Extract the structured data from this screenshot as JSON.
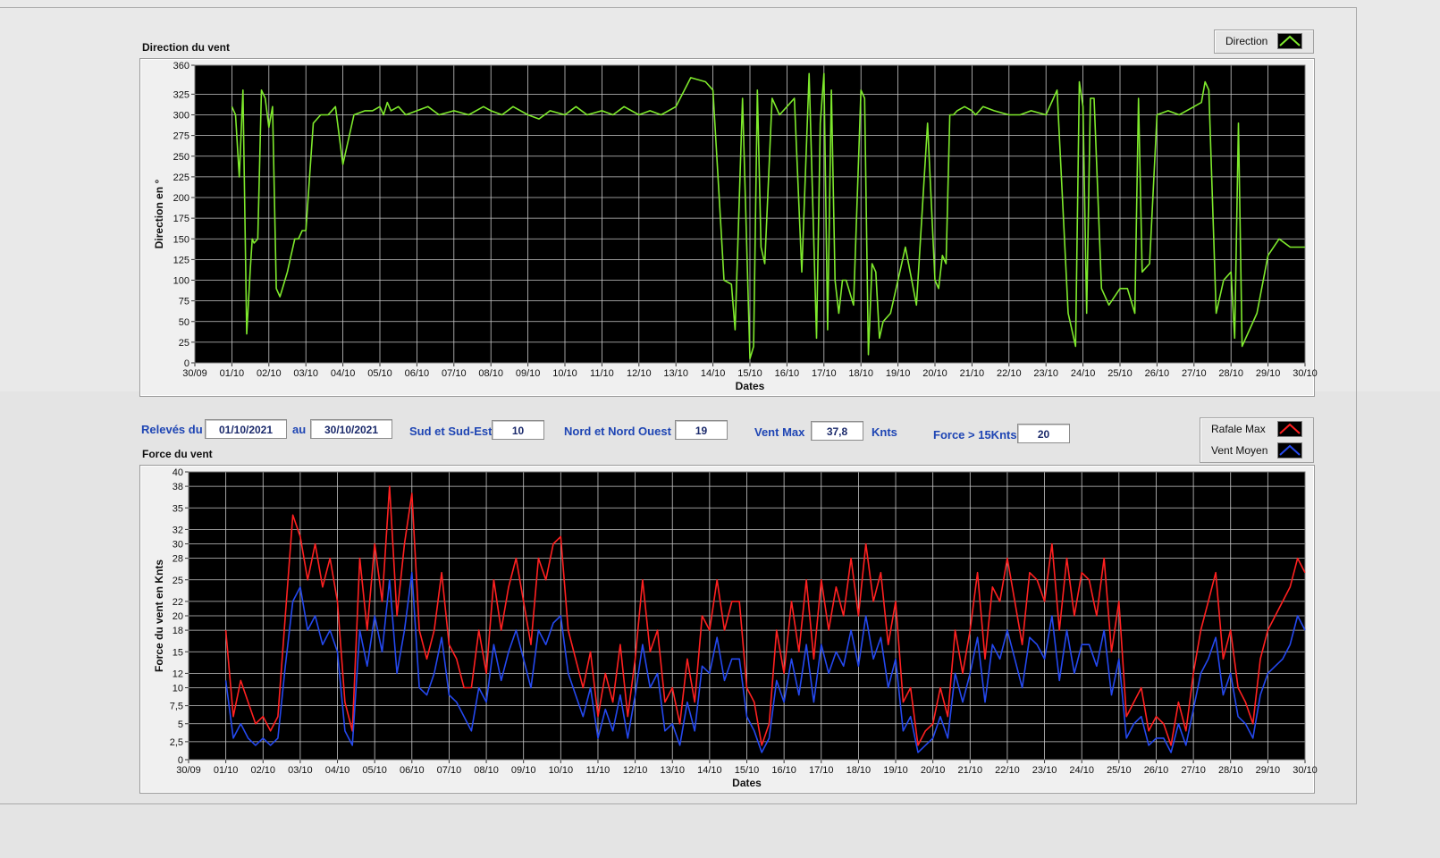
{
  "controls": {
    "releves_label": "Relevés du",
    "date_from": "01/10/2021",
    "au_label": "au",
    "date_to": "30/10/2021",
    "sud_label": "Sud et Sud-Est",
    "sud_value": "10",
    "nord_label": "Nord et Nord Ouest",
    "nord_value": "19",
    "ventmax_label": "Vent Max",
    "ventmax_value": "37,8",
    "knts_label": "Knts",
    "force_label": "Force > 15Knts",
    "force_value": "20"
  },
  "legends": {
    "direction": "Direction",
    "rafale": "Rafale Max",
    "moyen": "Vent Moyen"
  },
  "colors": {
    "plot_bg": "#000000",
    "grid": "#c8c8c8",
    "direction": "#7ee92c",
    "rafale": "#ff2020",
    "moyen": "#2448ee"
  },
  "chart_data": [
    {
      "type": "line",
      "title": "Direction du vent",
      "xlabel": "Dates",
      "ylabel": "Direction en °",
      "categories": [
        "30/09",
        "01/10",
        "02/10",
        "03/10",
        "04/10",
        "05/10",
        "06/10",
        "07/10",
        "08/10",
        "09/10",
        "10/10",
        "11/10",
        "12/10",
        "13/10",
        "14/10",
        "15/10",
        "16/10",
        "17/10",
        "18/10",
        "19/10",
        "20/10",
        "21/10",
        "22/10",
        "23/10",
        "24/10",
        "25/10",
        "26/10",
        "27/10",
        "28/10",
        "29/10",
        "30/10"
      ],
      "yticks": [
        0,
        25,
        50,
        75,
        100,
        125,
        150,
        175,
        200,
        225,
        250,
        275,
        300,
        325,
        360
      ],
      "ylim": [
        0,
        360
      ],
      "grid": true,
      "legend_position": "top-right",
      "series": [
        {
          "name": "Direction",
          "x": [
            1.0,
            1.1,
            1.2,
            1.3,
            1.4,
            1.5,
            1.55,
            1.6,
            1.7,
            1.8,
            1.9,
            2.0,
            2.1,
            2.2,
            2.3,
            2.4,
            2.5,
            2.6,
            2.7,
            2.8,
            2.9,
            3.0,
            3.2,
            3.4,
            3.6,
            3.7,
            3.8,
            4.0,
            4.3,
            4.6,
            4.8,
            5.0,
            5.1,
            5.2,
            5.3,
            5.5,
            5.7,
            6.0,
            6.3,
            6.6,
            7.0,
            7.4,
            7.8,
            8.0,
            8.3,
            8.6,
            9.0,
            9.3,
            9.6,
            10.0,
            10.3,
            10.6,
            11.0,
            11.3,
            11.6,
            12.0,
            12.3,
            12.6,
            13.0,
            13.4,
            13.8,
            14.0,
            14.3,
            14.5,
            14.6,
            14.8,
            15.0,
            15.1,
            15.2,
            15.3,
            15.4,
            15.6,
            15.8,
            16.0,
            16.2,
            16.4,
            16.6,
            16.8,
            16.9,
            17.0,
            17.1,
            17.2,
            17.3,
            17.4,
            17.5,
            17.6,
            17.8,
            18.0,
            18.1,
            18.2,
            18.3,
            18.4,
            18.5,
            18.6,
            18.8,
            19.0,
            19.2,
            19.5,
            19.8,
            20.0,
            20.1,
            20.2,
            20.3,
            20.4,
            20.5,
            20.6,
            20.8,
            21.0,
            21.1,
            21.3,
            21.6,
            22.0,
            22.3,
            22.6,
            23.0,
            23.3,
            23.6,
            23.8,
            23.9,
            24.0,
            24.1,
            24.2,
            24.3,
            24.5,
            24.7,
            25.0,
            25.2,
            25.4,
            25.5,
            25.6,
            25.8,
            26.0,
            26.3,
            26.6,
            27.0,
            27.2,
            27.3,
            27.4,
            27.6,
            27.8,
            28.0,
            28.1,
            28.2,
            28.3,
            28.5,
            28.7,
            29.0,
            29.3,
            29.6,
            30.0
          ],
          "values": [
            310,
            300,
            225,
            330,
            35,
            115,
            150,
            145,
            150,
            330,
            320,
            285,
            310,
            90,
            80,
            95,
            110,
            130,
            150,
            150,
            160,
            160,
            290,
            300,
            300,
            305,
            310,
            240,
            300,
            305,
            305,
            310,
            300,
            315,
            305,
            310,
            300,
            305,
            310,
            300,
            305,
            300,
            310,
            305,
            300,
            310,
            300,
            295,
            305,
            300,
            310,
            300,
            305,
            300,
            310,
            300,
            305,
            300,
            310,
            345,
            340,
            330,
            100,
            95,
            40,
            320,
            5,
            20,
            330,
            140,
            120,
            320,
            300,
            310,
            320,
            110,
            350,
            30,
            290,
            350,
            40,
            330,
            100,
            60,
            100,
            100,
            70,
            330,
            320,
            10,
            120,
            110,
            30,
            50,
            60,
            100,
            140,
            70,
            290,
            100,
            90,
            130,
            120,
            300,
            300,
            305,
            310,
            305,
            300,
            310,
            305,
            300,
            300,
            305,
            300,
            330,
            60,
            20,
            340,
            310,
            60,
            320,
            320,
            90,
            70,
            90,
            90,
            60,
            320,
            110,
            120,
            300,
            305,
            300,
            310,
            315,
            340,
            330,
            60,
            100,
            110,
            30,
            290,
            20,
            40,
            60,
            130,
            150,
            140,
            140
          ]
        }
      ]
    },
    {
      "type": "line",
      "title": "Force du vent",
      "xlabel": "Dates",
      "ylabel": "Force du vent en Knts",
      "categories": [
        "30/09",
        "01/10",
        "02/10",
        "03/10",
        "04/10",
        "05/10",
        "06/10",
        "07/10",
        "08/10",
        "09/10",
        "10/10",
        "11/10",
        "12/10",
        "13/10",
        "14/10",
        "15/10",
        "16/10",
        "17/10",
        "18/10",
        "19/10",
        "20/10",
        "21/10",
        "22/10",
        "23/10",
        "24/10",
        "25/10",
        "26/10",
        "27/10",
        "28/10",
        "29/10",
        "30/10"
      ],
      "yticks": [
        0,
        2.5,
        5,
        7.5,
        10,
        12,
        15,
        18,
        20,
        22,
        25,
        28,
        30,
        32,
        35,
        38,
        40
      ],
      "ytick_labels": [
        "0",
        "2,5",
        "5",
        "7,5",
        "10",
        "12",
        "15",
        "18",
        "20",
        "22",
        "25",
        "28",
        "30",
        "32",
        "35",
        "38",
        "40"
      ],
      "ylim": [
        0,
        40
      ],
      "grid": true,
      "legend_position": "top-right",
      "series": [
        {
          "name": "Rafale Max",
          "x": [
            1.0,
            1.2,
            1.4,
            1.6,
            1.8,
            2.0,
            2.2,
            2.4,
            2.6,
            2.8,
            3.0,
            3.2,
            3.4,
            3.6,
            3.8,
            4.0,
            4.2,
            4.4,
            4.6,
            4.8,
            5.0,
            5.2,
            5.4,
            5.6,
            5.8,
            6.0,
            6.2,
            6.4,
            6.6,
            6.8,
            7.0,
            7.2,
            7.4,
            7.6,
            7.8,
            8.0,
            8.2,
            8.4,
            8.6,
            8.8,
            9.0,
            9.2,
            9.4,
            9.6,
            9.8,
            10.0,
            10.2,
            10.4,
            10.6,
            10.8,
            11.0,
            11.2,
            11.4,
            11.6,
            11.8,
            12.0,
            12.2,
            12.4,
            12.6,
            12.8,
            13.0,
            13.2,
            13.4,
            13.6,
            13.8,
            14.0,
            14.2,
            14.4,
            14.6,
            14.8,
            15.0,
            15.2,
            15.4,
            15.6,
            15.8,
            16.0,
            16.2,
            16.4,
            16.6,
            16.8,
            17.0,
            17.2,
            17.4,
            17.6,
            17.8,
            18.0,
            18.2,
            18.4,
            18.6,
            18.8,
            19.0,
            19.2,
            19.4,
            19.6,
            19.8,
            20.0,
            20.2,
            20.4,
            20.6,
            20.8,
            21.0,
            21.2,
            21.4,
            21.6,
            21.8,
            22.0,
            22.2,
            22.4,
            22.6,
            22.8,
            23.0,
            23.2,
            23.4,
            23.6,
            23.8,
            24.0,
            24.2,
            24.4,
            24.6,
            24.8,
            25.0,
            25.2,
            25.4,
            25.6,
            25.8,
            26.0,
            26.2,
            26.4,
            26.6,
            26.8,
            27.0,
            27.2,
            27.4,
            27.6,
            27.8,
            28.0,
            28.2,
            28.4,
            28.6,
            28.8,
            29.0,
            29.2,
            29.4,
            29.6,
            29.8,
            30.0
          ],
          "values": [
            18,
            6,
            11,
            8,
            5,
            6,
            4,
            6,
            20,
            34,
            31,
            25,
            30,
            24,
            28,
            22,
            8,
            4,
            28,
            18,
            30,
            22,
            38,
            20,
            30,
            37,
            18,
            14,
            18,
            26,
            16,
            14,
            10,
            10,
            18,
            12,
            25,
            18,
            24,
            28,
            22,
            16,
            28,
            25,
            30,
            31,
            18,
            14,
            10,
            15,
            6,
            12,
            8,
            16,
            6,
            14,
            25,
            15,
            18,
            8,
            10,
            5,
            14,
            8,
            20,
            18,
            25,
            18,
            22,
            22,
            10,
            8,
            2,
            5,
            18,
            12,
            22,
            15,
            25,
            14,
            25,
            18,
            24,
            20,
            28,
            20,
            30,
            22,
            26,
            16,
            22,
            8,
            10,
            2,
            4,
            5,
            10,
            6,
            18,
            12,
            18,
            26,
            14,
            24,
            22,
            28,
            22,
            16,
            26,
            25,
            22,
            30,
            18,
            28,
            20,
            26,
            25,
            20,
            28,
            15,
            22,
            6,
            8,
            10,
            4,
            6,
            5,
            2,
            8,
            4,
            12,
            18,
            22,
            26,
            14,
            18,
            10,
            8,
            5,
            14,
            18,
            20,
            22,
            24,
            28,
            26
          ]
        },
        {
          "name": "Vent Moyen",
          "x": [
            1.0,
            1.2,
            1.4,
            1.6,
            1.8,
            2.0,
            2.2,
            2.4,
            2.6,
            2.8,
            3.0,
            3.2,
            3.4,
            3.6,
            3.8,
            4.0,
            4.2,
            4.4,
            4.6,
            4.8,
            5.0,
            5.2,
            5.4,
            5.6,
            5.8,
            6.0,
            6.2,
            6.4,
            6.6,
            6.8,
            7.0,
            7.2,
            7.4,
            7.6,
            7.8,
            8.0,
            8.2,
            8.4,
            8.6,
            8.8,
            9.0,
            9.2,
            9.4,
            9.6,
            9.8,
            10.0,
            10.2,
            10.4,
            10.6,
            10.8,
            11.0,
            11.2,
            11.4,
            11.6,
            11.8,
            12.0,
            12.2,
            12.4,
            12.6,
            12.8,
            13.0,
            13.2,
            13.4,
            13.6,
            13.8,
            14.0,
            14.2,
            14.4,
            14.6,
            14.8,
            15.0,
            15.2,
            15.4,
            15.6,
            15.8,
            16.0,
            16.2,
            16.4,
            16.6,
            16.8,
            17.0,
            17.2,
            17.4,
            17.6,
            17.8,
            18.0,
            18.2,
            18.4,
            18.6,
            18.8,
            19.0,
            19.2,
            19.4,
            19.6,
            19.8,
            20.0,
            20.2,
            20.4,
            20.6,
            20.8,
            21.0,
            21.2,
            21.4,
            21.6,
            21.8,
            22.0,
            22.2,
            22.4,
            22.6,
            22.8,
            23.0,
            23.2,
            23.4,
            23.6,
            23.8,
            24.0,
            24.2,
            24.4,
            24.6,
            24.8,
            25.0,
            25.2,
            25.4,
            25.6,
            25.8,
            26.0,
            26.2,
            26.4,
            26.6,
            26.8,
            27.0,
            27.2,
            27.4,
            27.6,
            27.8,
            28.0,
            28.2,
            28.4,
            28.6,
            28.8,
            29.0,
            29.2,
            29.4,
            29.6,
            29.8,
            30.0
          ],
          "values": [
            11,
            3,
            5,
            3,
            2,
            3,
            2,
            3,
            13,
            22,
            24,
            18,
            20,
            16,
            18,
            15,
            4,
            2,
            18,
            13,
            20,
            15,
            25,
            12,
            18,
            26,
            10,
            9,
            12,
            17,
            9,
            8,
            6,
            4,
            10,
            8,
            16,
            11,
            15,
            18,
            14,
            10,
            18,
            16,
            19,
            20,
            12,
            9,
            6,
            10,
            3,
            7,
            4,
            9,
            3,
            9,
            16,
            10,
            12,
            4,
            5,
            2,
            8,
            4,
            13,
            12,
            17,
            11,
            14,
            14,
            6,
            4,
            1,
            3,
            11,
            8,
            14,
            9,
            16,
            8,
            16,
            12,
            15,
            13,
            18,
            13,
            20,
            14,
            17,
            10,
            14,
            4,
            6,
            1,
            2,
            3,
            6,
            3,
            12,
            8,
            12,
            17,
            8,
            16,
            14,
            18,
            14,
            10,
            17,
            16,
            14,
            20,
            11,
            18,
            12,
            16,
            16,
            13,
            18,
            9,
            14,
            3,
            5,
            6,
            2,
            3,
            3,
            1,
            5,
            2,
            7,
            12,
            14,
            17,
            9,
            12,
            6,
            5,
            3,
            9,
            12,
            13,
            14,
            16,
            20,
            18
          ]
        }
      ]
    }
  ]
}
